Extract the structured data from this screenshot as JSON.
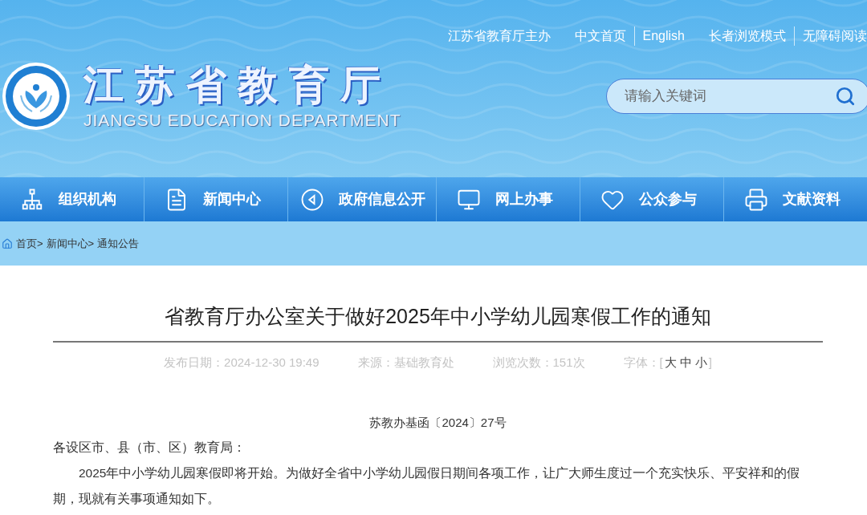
{
  "header": {
    "host": "江苏省教育厅主办",
    "link_groups": [
      [
        "中文首页",
        "English"
      ],
      [
        "长者浏览模式",
        "无障碍阅读"
      ]
    ],
    "site_name": "江苏省教育厅",
    "site_name_en": "JIANGSU EDUCATION DEPARTMENT",
    "search": {
      "placeholder": "请输入关键词"
    }
  },
  "nav": [
    "组织机构",
    "新闻中心",
    "政府信息公开",
    "网上办事",
    "公众参与",
    "文献资料"
  ],
  "breadcrumb": {
    "items": [
      "首页",
      "新闻中心",
      "通知公告"
    ],
    "separator": ">"
  },
  "article": {
    "title": "省教育厅办公室关于做好2025年中小学幼儿园寒假工作的通知",
    "meta": [
      {
        "label": "发布日期：",
        "value": "2024-12-30 19:49"
      },
      {
        "label": "来源：",
        "value": "基础教育处"
      },
      {
        "label": "浏览次数：",
        "value": "151次"
      }
    ],
    "font_size": {
      "label": "字体：",
      "open": "[",
      "close": "]",
      "options": [
        "大",
        "中",
        "小"
      ]
    },
    "doc_number": "苏教办基函〔2024〕27号",
    "paragraphs": [
      {
        "text": "各设区市、县（市、区）教育局：",
        "kind": "salutation"
      },
      {
        "text": "2025年中小学幼儿园寒假即将开始。为做好全省中小学幼儿园假日期间各项工作，让广大师生度过一个充实快乐、平安祥和的假期，现就有关事项通知如下。",
        "kind": "body"
      }
    ]
  }
}
